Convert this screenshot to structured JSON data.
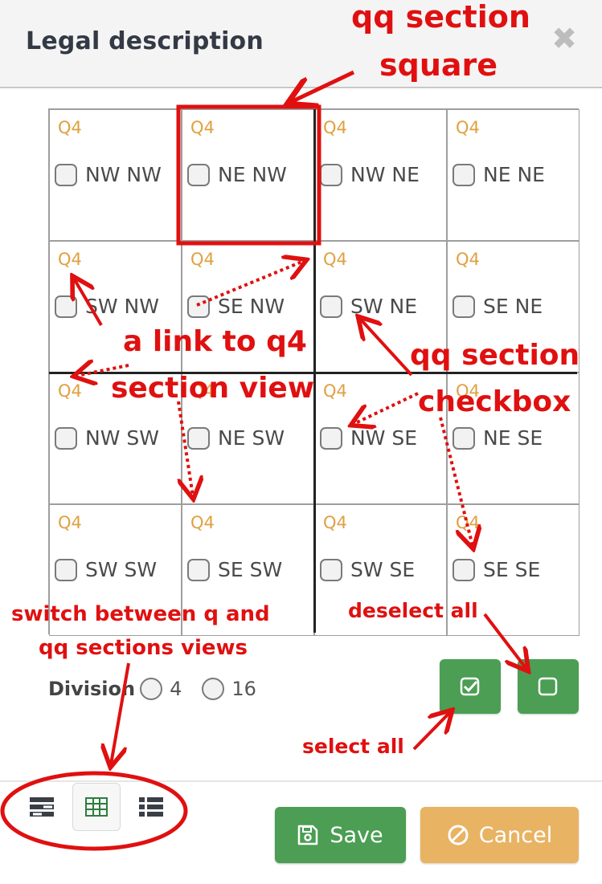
{
  "dialog": {
    "title": "Legal description"
  },
  "grid": {
    "rows": [
      [
        {
          "link": "Q4",
          "label": "NW NW"
        },
        {
          "link": "Q4",
          "label": "NE NW"
        },
        {
          "link": "Q4",
          "label": "NW NE"
        },
        {
          "link": "Q4",
          "label": "NE NE"
        }
      ],
      [
        {
          "link": "Q4",
          "label": "SW NW"
        },
        {
          "link": "Q4",
          "label": "SE NW"
        },
        {
          "link": "Q4",
          "label": "SW NE"
        },
        {
          "link": "Q4",
          "label": "SE NE"
        }
      ],
      [
        {
          "link": "Q4",
          "label": "NW SW"
        },
        {
          "link": "Q4",
          "label": "NE SW"
        },
        {
          "link": "Q4",
          "label": "NW SE"
        },
        {
          "link": "Q4",
          "label": "NE SE"
        }
      ],
      [
        {
          "link": "Q4",
          "label": "SW SW"
        },
        {
          "link": "Q4",
          "label": "SE SW"
        },
        {
          "link": "Q4",
          "label": "SW SE"
        },
        {
          "link": "Q4",
          "label": "SE SE"
        }
      ]
    ]
  },
  "division": {
    "label": "Division",
    "options": [
      "4",
      "16"
    ]
  },
  "actions": {
    "save": "Save",
    "cancel": "Cancel"
  },
  "icons": {
    "close": "close-icon",
    "select_all": "checkbox-checked-icon",
    "deselect_all": "checkbox-empty-icon",
    "views": [
      "list-detail-icon",
      "grid-icon",
      "list-icon"
    ],
    "save": "floppy-disk-icon",
    "cancel": "ban-icon"
  },
  "colors": {
    "green": "#4b9e53",
    "orange": "#e8b363",
    "q4_link": "#e0a040",
    "annotation": "#e01010"
  },
  "annotations": {
    "qq_square_1": "qq section",
    "qq_square_2": "square",
    "q4_link_1": "a link to q4",
    "q4_link_2": "section view",
    "qq_checkbox_1": "qq section",
    "qq_checkbox_2": "checkbox",
    "switch_1": "switch between q and",
    "switch_2": "qq sections views",
    "deselect_all": "deselect all",
    "select_all": "select all"
  }
}
